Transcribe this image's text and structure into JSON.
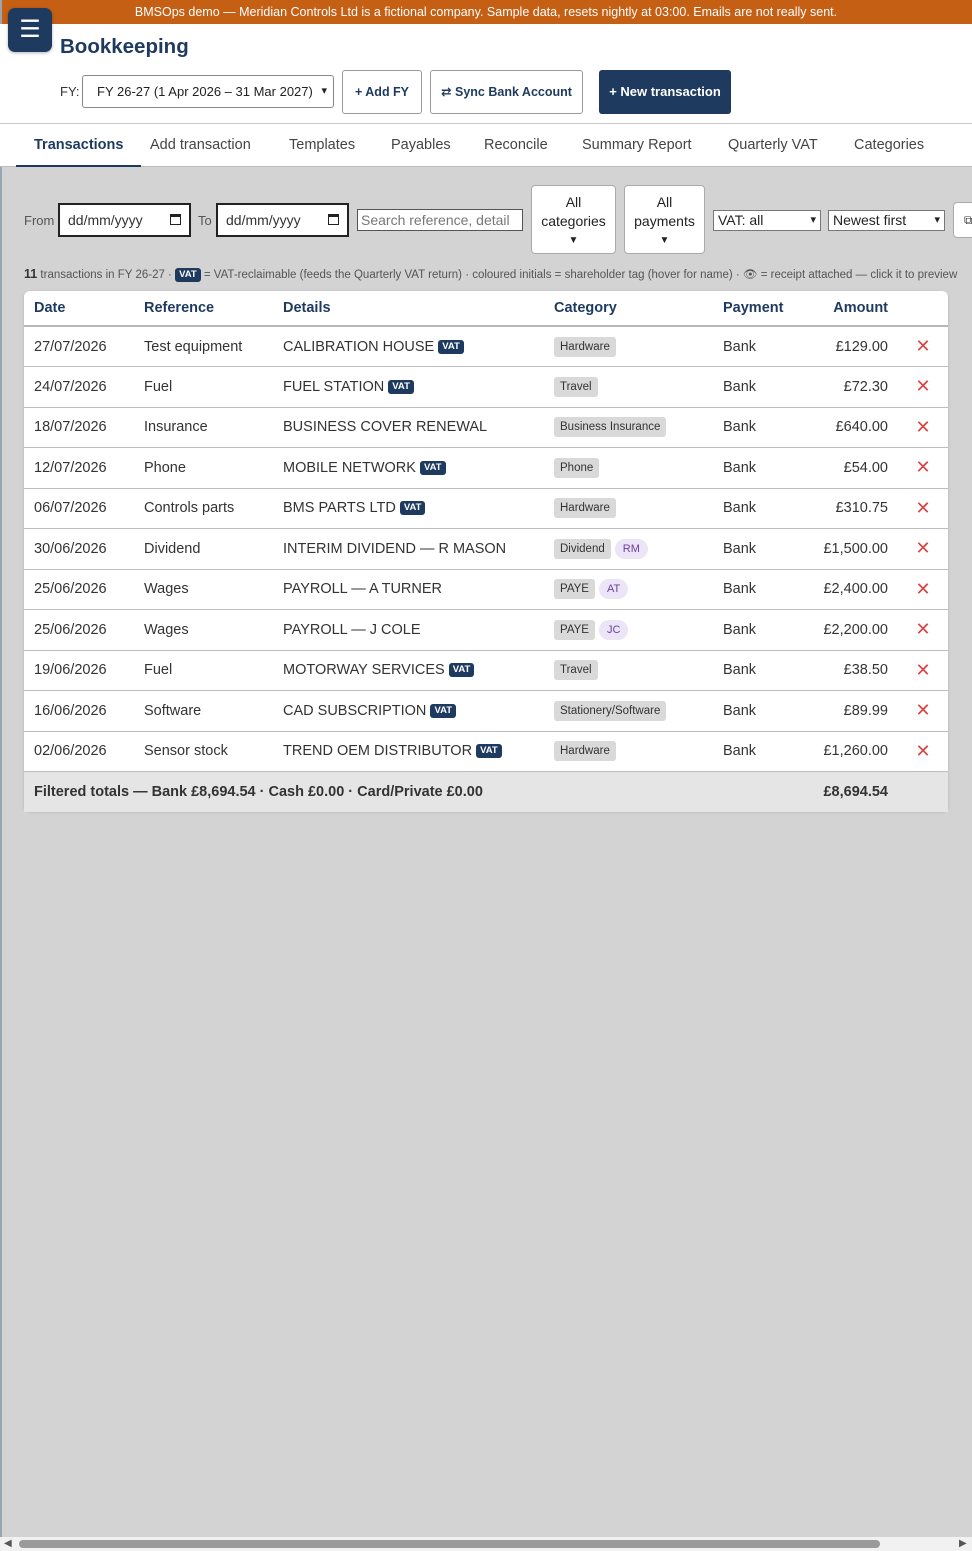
{
  "banner": {
    "text": "BMSOps demo — Meridian Controls Ltd is a fictional company. Sample data, resets nightly at 03:00. Emails are not really sent."
  },
  "header": {
    "menu_icon": "☰",
    "title": "Bookkeeping",
    "fy_label": "FY:",
    "fy_selected": "FY 26-27 (1 Apr 2026 – 31 Mar 2027)",
    "add_fy": "+ Add FY",
    "sync_bank": "⇄ Sync Bank Account",
    "new_transaction": "+ New transaction"
  },
  "tabs": [
    {
      "label": "Transactions",
      "active": true
    },
    {
      "label": "Add transaction"
    },
    {
      "label": "Templates"
    },
    {
      "label": "Payables"
    },
    {
      "label": "Reconcile"
    },
    {
      "label": "Summary Report"
    },
    {
      "label": "Quarterly VAT"
    },
    {
      "label": "Categories"
    }
  ],
  "filters": {
    "from_label": "From",
    "from_value": "dd/mm/yyyy",
    "to_label": "To",
    "to_value": "dd/mm/yyyy",
    "search_placeholder": "Search reference, detail",
    "categories_line1": "All",
    "categories_line2": "categories",
    "payments_line1": "All",
    "payments_line2": "payments",
    "vat_select": "VAT: all",
    "sort_select": "Newest first"
  },
  "info": {
    "count": "11",
    "text1": "transactions in FY 26-27 ·",
    "vat_badge": "VAT",
    "text2": "= VAT-reclaimable (feeds the Quarterly VAT return) · coloured initials = shareholder tag (hover for name) · 👁 = receipt attached — click it to preview"
  },
  "table": {
    "headers": [
      "Date",
      "Reference",
      "Details",
      "Category",
      "Payment",
      "Amount"
    ],
    "rows": [
      {
        "date": "27/07/2026",
        "reference": "Test equipment",
        "details": "CALIBRATION HOUSE",
        "vat": "VAT",
        "category": "Hardware",
        "shareholder": "",
        "payment": "Bank",
        "amount": "£129.00"
      },
      {
        "date": "24/07/2026",
        "reference": "Fuel",
        "details": "FUEL STATION",
        "vat": "VAT",
        "category": "Travel",
        "shareholder": "",
        "payment": "Bank",
        "amount": "£72.30"
      },
      {
        "date": "18/07/2026",
        "reference": "Insurance",
        "details": "BUSINESS COVER RENEWAL",
        "vat": "",
        "category": "Business Insurance",
        "shareholder": "",
        "payment": "Bank",
        "amount": "£640.00"
      },
      {
        "date": "12/07/2026",
        "reference": "Phone",
        "details": "MOBILE NETWORK",
        "vat": "VAT",
        "category": "Phone",
        "shareholder": "",
        "payment": "Bank",
        "amount": "£54.00"
      },
      {
        "date": "06/07/2026",
        "reference": "Controls parts",
        "details": "BMS PARTS LTD",
        "vat": "VAT",
        "category": "Hardware",
        "shareholder": "",
        "payment": "Bank",
        "amount": "£310.75"
      },
      {
        "date": "30/06/2026",
        "reference": "Dividend",
        "details": "INTERIM DIVIDEND — R MASON",
        "vat": "",
        "category": "Dividend",
        "shareholder": "RM",
        "payment": "Bank",
        "amount": "£1,500.00"
      },
      {
        "date": "25/06/2026",
        "reference": "Wages",
        "details": "PAYROLL — A TURNER",
        "vat": "",
        "category": "PAYE",
        "shareholder": "AT",
        "payment": "Bank",
        "amount": "£2,400.00"
      },
      {
        "date": "25/06/2026",
        "reference": "Wages",
        "details": "PAYROLL — J COLE",
        "vat": "",
        "category": "PAYE",
        "shareholder": "JC",
        "payment": "Bank",
        "amount": "£2,200.00"
      },
      {
        "date": "19/06/2026",
        "reference": "Fuel",
        "details": "MOTORWAY SERVICES",
        "vat": "VAT",
        "category": "Travel",
        "shareholder": "",
        "payment": "Bank",
        "amount": "£38.50"
      },
      {
        "date": "16/06/2026",
        "reference": "Software",
        "details": "CAD SUBSCRIPTION",
        "vat": "VAT",
        "category": "Stationery/Software",
        "shareholder": "",
        "payment": "Bank",
        "amount": "£89.99"
      },
      {
        "date": "02/06/2026",
        "reference": "Sensor stock",
        "details": "TREND OEM DISTRIBUTOR",
        "vat": "VAT",
        "category": "Hardware",
        "shareholder": "",
        "payment": "Bank",
        "amount": "£1,260.00"
      }
    ],
    "delete_icon": "✕",
    "totals_label": "Filtered totals — Bank £8,694.54 · Cash £0.00 · Card/Private £0.00",
    "totals_amount": "£8,694.54"
  },
  "colors": {
    "banner": "#c55f14",
    "primary": "#1e3a5f",
    "delete": "#d64545",
    "shareholder_bg": "#ece4f7",
    "shareholder_text": "#6b3fa0"
  }
}
